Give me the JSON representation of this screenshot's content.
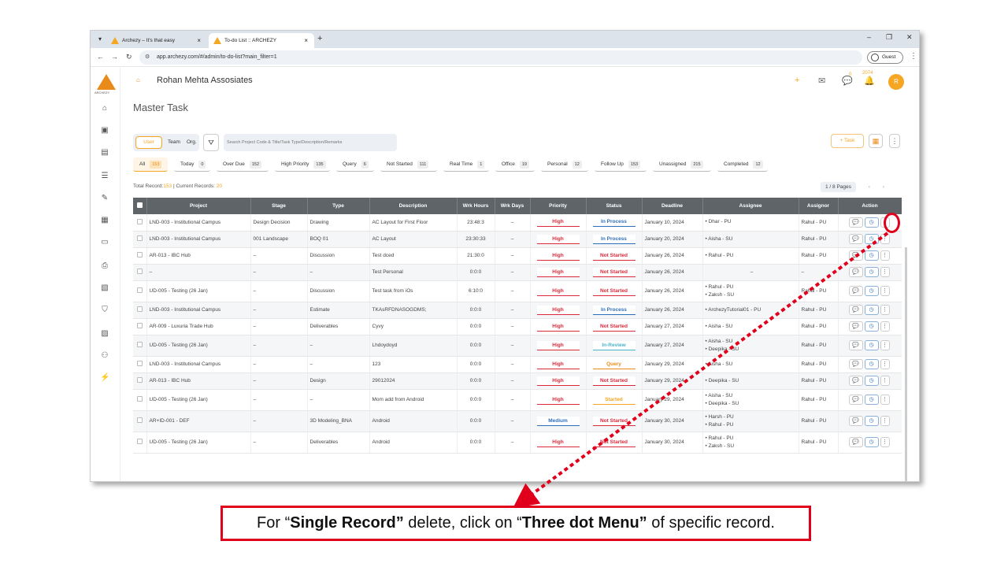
{
  "browser": {
    "tabs": [
      {
        "label": "Archezy – It's that easy",
        "close": "×"
      },
      {
        "label": "To-do List :: ARCHEZY",
        "close": "×"
      }
    ],
    "tab_menu_icon": "▾",
    "new_tab_icon": "+",
    "url": "app.archezy.com/#/admin/to-do-list?main_filter=1",
    "profile_label": "Guest",
    "window_controls": {
      "minimize": "–",
      "maximize": "❐",
      "close": "✕"
    }
  },
  "sidebar": {
    "logo_text": "ARCHEZY",
    "icons": [
      {
        "name": "home-icon",
        "glyph": "⌂"
      },
      {
        "name": "building-icon",
        "glyph": "▣"
      },
      {
        "name": "clipboard-icon",
        "glyph": "▤"
      },
      {
        "name": "list-icon",
        "glyph": "☰"
      },
      {
        "name": "edit-icon",
        "glyph": "✎"
      },
      {
        "name": "report-icon",
        "glyph": "▦"
      },
      {
        "name": "book-icon",
        "glyph": "▭"
      },
      {
        "name": "printer-icon",
        "glyph": "⎙"
      },
      {
        "name": "gallery-icon",
        "glyph": "▧"
      },
      {
        "name": "shield-icon",
        "glyph": "⛉"
      },
      {
        "name": "task-check-icon",
        "glyph": "▨"
      },
      {
        "name": "network-icon",
        "glyph": "⚇"
      },
      {
        "name": "lightning-icon",
        "glyph": "⚡"
      }
    ]
  },
  "header": {
    "company_name": "Rohan Mehta Assosiates",
    "chat_badge": "0",
    "notification_badge": "2074",
    "avatar_initial": "R"
  },
  "page": {
    "title": "Master Task",
    "toggle": {
      "user": "User",
      "team": "Team",
      "org": "Org."
    },
    "search_placeholder": "Search Project Code & Title/Task Type/Description/Remarks",
    "add_task_label": "+ Task",
    "filters": [
      {
        "label": "All",
        "count": "153",
        "active": true
      },
      {
        "label": "Today",
        "count": "0"
      },
      {
        "label": "Over Due",
        "count": "152"
      },
      {
        "label": "High Priority",
        "count": "135"
      },
      {
        "label": "Query",
        "count": "6"
      },
      {
        "label": "Not Started",
        "count": "111"
      },
      {
        "label": "Real Time",
        "count": "1"
      },
      {
        "label": "Office",
        "count": "19"
      },
      {
        "label": "Personal",
        "count": "12"
      },
      {
        "label": "Follow Up",
        "count": "153"
      },
      {
        "label": "Unassigned",
        "count": "215"
      },
      {
        "label": "Completed",
        "count": "12"
      }
    ],
    "totals": {
      "label1": "Total Record:",
      "total": "153",
      "label2": " | Current Records: ",
      "current": "20"
    },
    "pager": {
      "text": "1 / 8 Pages",
      "prev": "‹",
      "next": "›"
    }
  },
  "table": {
    "columns": [
      "Project",
      "Stage",
      "Type",
      "Description",
      "Wrk Hours",
      "Wrk Days",
      "Priority",
      "Status",
      "Deadline",
      "Assignee",
      "Assignor",
      "Action"
    ],
    "rows": [
      {
        "project": "LND-003 - Institutional Campus",
        "stage": "Design Decision",
        "type": "Drawing",
        "desc": "AC Layout for First Floor",
        "hours": "23:48:3",
        "days": "–",
        "priority": "High",
        "status": "In Process",
        "deadline": "January 10, 2024",
        "assignee": [
          "Dhar - PU"
        ],
        "assignor": "Rahul - PU"
      },
      {
        "project": "LND-003 - Institutional Campus",
        "stage": "001 Landscape",
        "type": "BOQ 01",
        "desc": "AC Layout",
        "hours": "23:30:33",
        "days": "–",
        "priority": "High",
        "status": "In Process",
        "deadline": "January 20, 2024",
        "assignee": [
          "Aisha - SU"
        ],
        "assignor": "Rahul - PU"
      },
      {
        "project": "AR-013 - IBC Hub",
        "stage": "–",
        "type": "Discussion",
        "desc": "Test dced",
        "hours": "21:30:0",
        "days": "–",
        "priority": "High",
        "status": "Not Started",
        "deadline": "January 26, 2024",
        "assignee": [
          "Rahul - PU"
        ],
        "assignor": "Rahul - PU"
      },
      {
        "project": "–",
        "stage": "–",
        "type": "–",
        "desc": "Test Personal",
        "hours": "0:0:0",
        "days": "–",
        "priority": "High",
        "status": "Not Started",
        "deadline": "January 26, 2024",
        "assignee": [],
        "assignee_blank": "–",
        "assignor": "–"
      },
      {
        "project": "UD-005 - Testing (26 Jan)",
        "stage": "–",
        "type": "Discussion",
        "desc": "Test task from iOs",
        "hours": "6:10:0",
        "days": "–",
        "priority": "High",
        "status": "Not Started",
        "deadline": "January 26, 2024",
        "assignee": [
          "Rahul - PU",
          "Zaksh - SU"
        ],
        "assignor": "Rahul - PU"
      },
      {
        "project": "LND-003 - Institutional Campus",
        "stage": "–",
        "type": "Estimate",
        "desc": "TKAsRFDNASOGDMS;",
        "hours": "0:0:0",
        "days": "–",
        "priority": "High",
        "status": "In Process",
        "deadline": "January 26, 2024",
        "assignee": [
          "ArchezyTutorial01 - PU"
        ],
        "assignor": "Rahul - PU"
      },
      {
        "project": "AR-009 - Luxuria Trade Hub",
        "stage": "–",
        "type": "Deliverables",
        "desc": "Cyvy",
        "hours": "0:0:0",
        "days": "–",
        "priority": "High",
        "status": "Not Started",
        "deadline": "January 27, 2024",
        "assignee": [
          "Aisha - SU"
        ],
        "assignor": "Rahul - PU"
      },
      {
        "project": "UD-005 - Testing (26 Jan)",
        "stage": "–",
        "type": "–",
        "desc": "Lhdoydoyd",
        "hours": "0:0:0",
        "days": "–",
        "priority": "High",
        "status": "In-Review",
        "deadline": "January 27, 2024",
        "assignee": [
          "Aisha - SU",
          "Deepika - SU"
        ],
        "assignor": "Rahul - PU"
      },
      {
        "project": "LND-003 - Institutional Campus",
        "stage": "–",
        "type": "–",
        "desc": "123",
        "hours": "0:0:0",
        "days": "–",
        "priority": "High",
        "status": "Query",
        "deadline": "January 29, 2024",
        "assignee": [
          "Aisha - SU"
        ],
        "assignor": "Rahul - PU"
      },
      {
        "project": "AR-013 - IBC Hub",
        "stage": "–",
        "type": "Design",
        "desc": "29012024",
        "hours": "0:0:0",
        "days": "–",
        "priority": "High",
        "status": "Not Started",
        "deadline": "January 29, 2024",
        "assignee": [
          "Deepika - SU"
        ],
        "assignor": "Rahul - PU"
      },
      {
        "project": "UD-005 - Testing (26 Jan)",
        "stage": "–",
        "type": "–",
        "desc": "Mom add from Android",
        "hours": "0:0:0",
        "days": "–",
        "priority": "High",
        "status": "Started",
        "deadline": "January 29, 2024",
        "assignee": [
          "Aisha - SU",
          "Deepika - SU"
        ],
        "assignor": "Rahul - PU"
      },
      {
        "project": "AR+ID-001 - DEF",
        "stage": "–",
        "type": "3D Modeling_BNA",
        "desc": "Android",
        "hours": "0:0:0",
        "days": "–",
        "priority": "Medium",
        "status": "Not Started",
        "deadline": "January 30, 2024",
        "assignee": [
          "Harsh - PU",
          "Rahul - PU"
        ],
        "assignor": "Rahul - PU"
      },
      {
        "project": "UD-005 - Testing (26 Jan)",
        "stage": "–",
        "type": "Deliverables",
        "desc": "Android",
        "hours": "0:0:0",
        "days": "–",
        "priority": "High",
        "status": "Not Started",
        "deadline": "January 30, 2024",
        "assignee": [
          "Rahul - PU",
          "Zaksh - SU"
        ],
        "assignor": "Rahul - PU"
      }
    ]
  },
  "annotation": {
    "part1": "For “",
    "bold1": "Single Record”",
    "part2": " delete, click on “",
    "bold2": "Three dot Menu”",
    "part3": " of specific record."
  },
  "colors": {
    "accent": "#f5a623",
    "high": "#d9293a",
    "in_process": "#2e6fba",
    "annotation": "#e0001b"
  }
}
